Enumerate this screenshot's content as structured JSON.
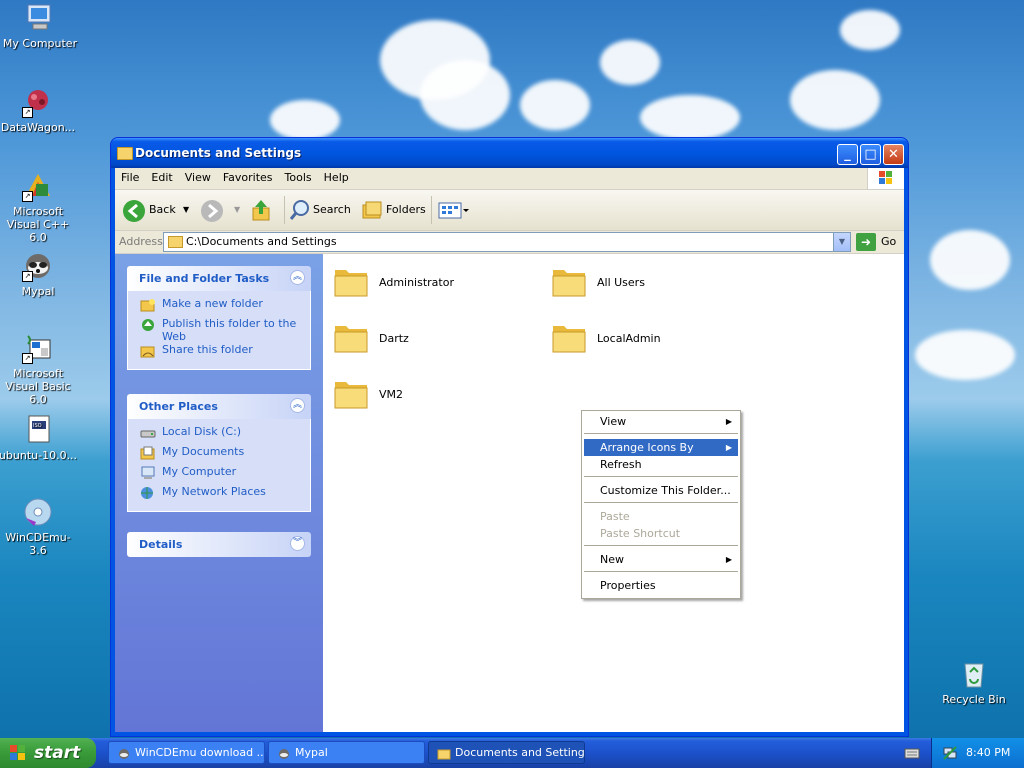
{
  "desktop": {
    "icons": [
      {
        "label": "My Computer"
      },
      {
        "label": "DataWagon..."
      },
      {
        "label": "Microsoft Visual C++ 6.0"
      },
      {
        "label": "Mypal"
      },
      {
        "label": "Microsoft Visual Basic 6.0"
      },
      {
        "label": "ubuntu-10.0..."
      },
      {
        "label": "WinCDEmu-3.6"
      },
      {
        "label": "Recycle Bin"
      }
    ]
  },
  "window": {
    "title": "Documents and Settings",
    "menu": [
      "File",
      "Edit",
      "View",
      "Favorites",
      "Tools",
      "Help"
    ],
    "toolbar": {
      "back_label": "Back",
      "search_label": "Search",
      "folders_label": "Folders"
    },
    "address": {
      "label": "Address",
      "value": "C:\\Documents and Settings",
      "go_label": "Go"
    },
    "tasks_panel": {
      "title": "File and Folder Tasks",
      "items": [
        "Make a new folder",
        "Publish this folder to the Web",
        "Share this folder"
      ]
    },
    "places_panel": {
      "title": "Other Places",
      "items": [
        "Local Disk (C:)",
        "My Documents",
        "My Computer",
        "My Network Places"
      ]
    },
    "details_panel": {
      "title": "Details"
    },
    "folders": [
      "Administrator",
      "All Users",
      "Dartz",
      "LocalAdmin",
      "VM2"
    ]
  },
  "context_menu": {
    "items": [
      {
        "label": "View",
        "submenu": true,
        "state": "normal"
      },
      {
        "label": "Arrange Icons By",
        "submenu": true,
        "state": "selected"
      },
      {
        "label": "Refresh",
        "submenu": false,
        "state": "normal"
      },
      {
        "label": "Customize This Folder...",
        "submenu": false,
        "state": "normal"
      },
      {
        "label": "Paste",
        "submenu": false,
        "state": "disabled"
      },
      {
        "label": "Paste Shortcut",
        "submenu": false,
        "state": "disabled"
      },
      {
        "label": "New",
        "submenu": true,
        "state": "normal"
      },
      {
        "label": "Properties",
        "submenu": false,
        "state": "normal"
      }
    ]
  },
  "taskbar": {
    "start_label": "start",
    "tasks": [
      "WinCDEmu download ...",
      "Mypal",
      "Documents and Settings"
    ],
    "clock": "8:40 PM"
  },
  "colors": {
    "xp_blue": "#0054e3",
    "selection": "#316ac5",
    "link_blue": "#215dc6",
    "start_green": "#3a9c3a"
  }
}
